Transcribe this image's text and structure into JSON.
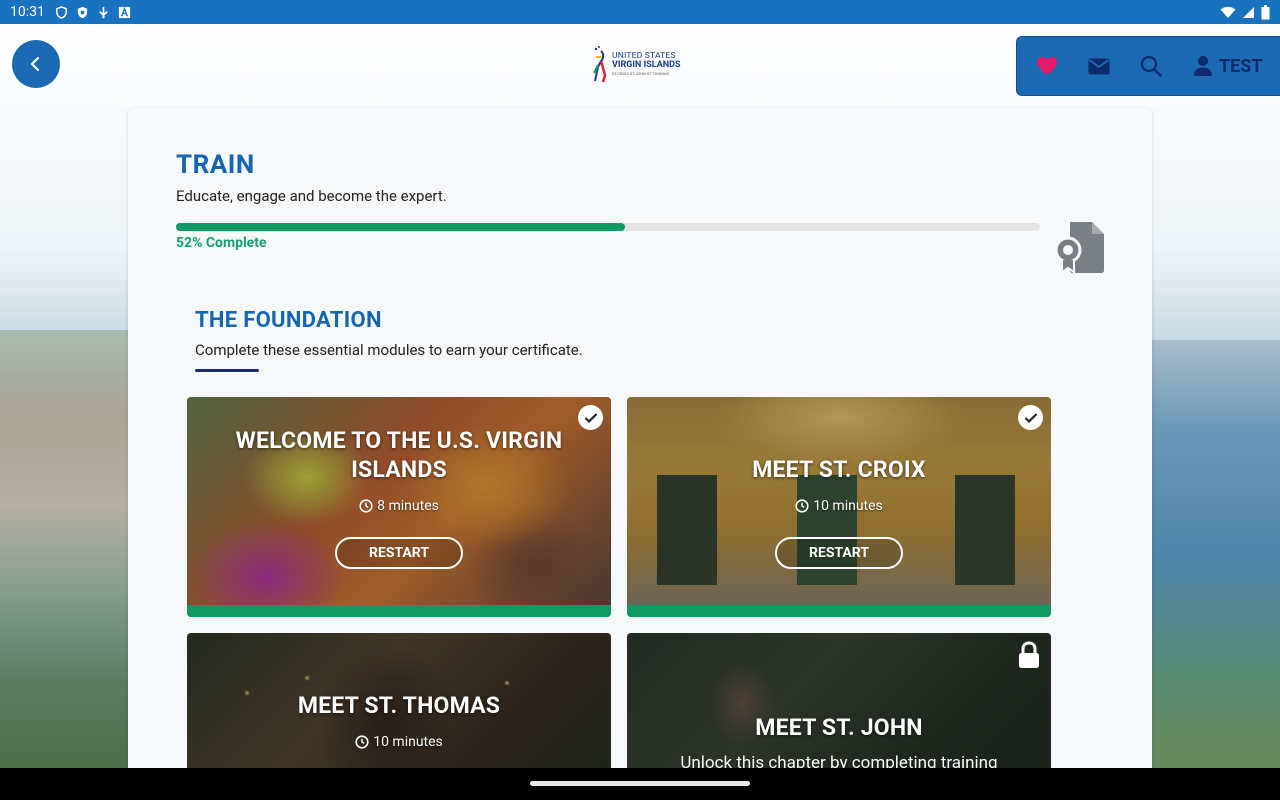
{
  "status_bar": {
    "time": "10:31"
  },
  "header": {
    "logo": {
      "line1": "UNITED STATES",
      "line2": "VIRGIN ISLANDS",
      "line3": "ST.CROIX   ST.JOHN   ST.THOMAS"
    },
    "user_label": "TEST"
  },
  "train": {
    "title": "TRAIN",
    "subtitle": "Educate, engage and become the expert.",
    "progress_percent": 52,
    "progress_label": "52% Complete"
  },
  "section": {
    "title": "THE FOUNDATION",
    "subtitle": "Complete these essential modules to earn your certificate."
  },
  "modules": [
    {
      "title": "WELCOME TO THE U.S. VIRGIN ISLANDS",
      "duration": "8 minutes",
      "button": "RESTART",
      "status": "complete"
    },
    {
      "title": "MEET ST. CROIX",
      "duration": "10 minutes",
      "button": "RESTART",
      "status": "complete"
    },
    {
      "title": "MEET ST. THOMAS",
      "duration": "10 minutes",
      "status": "available"
    },
    {
      "title": "MEET ST. JOHN",
      "lock_message": "Unlock this chapter by completing training",
      "status": "locked"
    }
  ],
  "colors": {
    "brand_blue": "#1b6ab3",
    "title_blue": "#1466b3",
    "progress_green": "#0f9a64",
    "heart_pink": "#e8196b",
    "user_navy": "#0d2a6e"
  }
}
